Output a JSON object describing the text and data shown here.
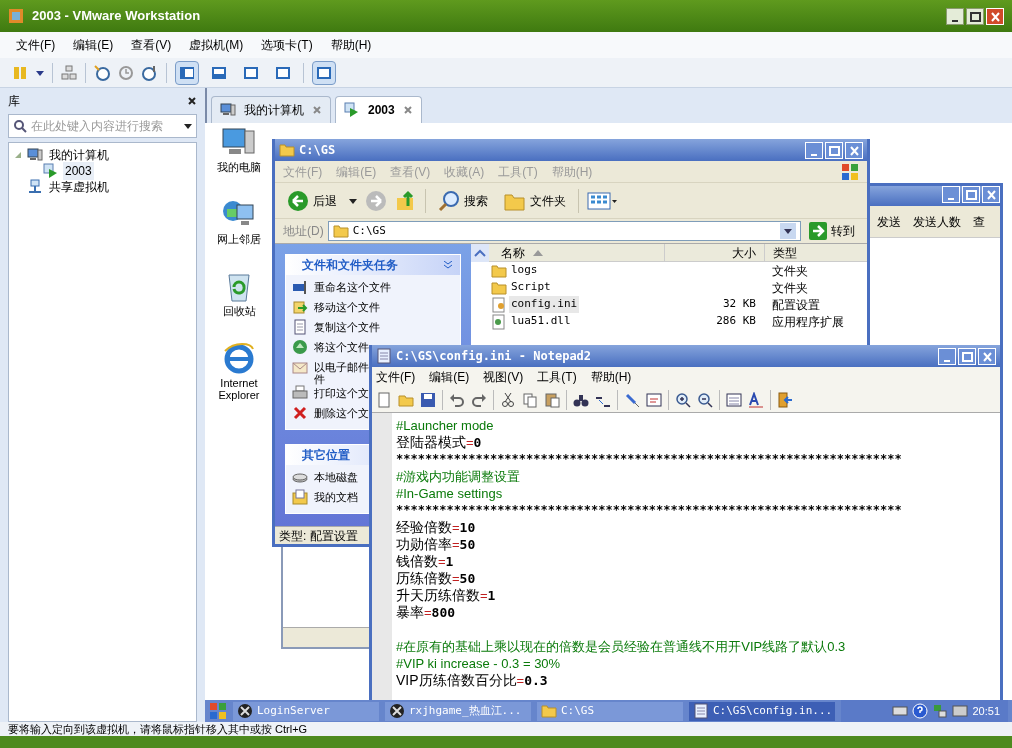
{
  "window": {
    "title": "2003 - VMware Workstation"
  },
  "menu": [
    "文件(F)",
    "编辑(E)",
    "查看(V)",
    "虚拟机(M)",
    "选项卡(T)",
    "帮助(H)"
  ],
  "view_buttons": [
    {
      "selected": true
    },
    {
      "selected": false
    },
    {
      "selected": false
    },
    {
      "selected": false
    },
    {
      "selected": true
    }
  ],
  "library": {
    "title": "库",
    "search": {
      "placeholder": "在此处键入内容进行搜索"
    },
    "tree": [
      {
        "label": "我的计算机",
        "kind": "computer",
        "expanded": true,
        "selected": false,
        "children": [
          {
            "label": "2003",
            "kind": "vm",
            "selected": true
          }
        ]
      },
      {
        "label": "共享虚拟机",
        "kind": "shared",
        "selected": false
      }
    ]
  },
  "tabs": [
    {
      "label": "我的计算机",
      "kind": "computer",
      "selected": false
    },
    {
      "label": "2003",
      "kind": "vm",
      "selected": true
    }
  ],
  "desktop_icons": [
    {
      "label": "我的电脑",
      "kind": "computer"
    },
    {
      "label": "网上邻居",
      "kind": "network"
    },
    {
      "label": "回收站",
      "kind": "recycle"
    },
    {
      "label": "Internet Explorer",
      "kind": "browser"
    }
  ],
  "background_window": {
    "toolbar": [
      "发送",
      "发送人数",
      "查"
    ]
  },
  "explorer": {
    "title": "C:\\GS",
    "menu": [
      "文件(F)",
      "编辑(E)",
      "查看(V)",
      "收藏(A)",
      "工具(T)",
      "帮助(H)"
    ],
    "back": "后退",
    "search": "搜索",
    "folders": "文件夹",
    "address_label": "地址(D)",
    "address": "C:\\GS",
    "go": "转到",
    "panels": [
      {
        "title": "文件和文件夹任务",
        "items": [
          {
            "label": "重命名这个文件",
            "kind": "rename",
            "wrapped": false
          },
          {
            "label": "移动这个文件",
            "kind": "move",
            "wrapped": false
          },
          {
            "label": "复制这个文件",
            "kind": "copy",
            "wrapped": false
          },
          {
            "label": "将这个文件",
            "kind": "web",
            "wrapped": false
          },
          {
            "label": "以电子邮件件",
            "kind": "mail",
            "wrapped": true
          },
          {
            "label": "打印这个文",
            "kind": "print",
            "wrapped": false
          },
          {
            "label": "删除这个文",
            "kind": "delete",
            "wrapped": false
          }
        ]
      },
      {
        "title": "其它位置",
        "items": [
          {
            "label": "本地磁盘",
            "kind": "disk",
            "wrapped": false
          },
          {
            "label": "我的文档",
            "kind": "documents",
            "wrapped": false
          }
        ]
      }
    ],
    "columns": [
      "名称",
      "大小",
      "类型"
    ],
    "rows": [
      {
        "name": "logs",
        "type": "文件夹",
        "kind": "folder",
        "selected": false
      },
      {
        "name": "Script",
        "type": "文件夹",
        "kind": "folder",
        "selected": false
      },
      {
        "name": "config.ini",
        "size": "32 KB",
        "type": "配置设置",
        "kind": "ini",
        "selected": true
      },
      {
        "name": "lua51.dll",
        "size": "286 KB",
        "type": "应用程序扩展",
        "kind": "dll",
        "selected": false
      }
    ],
    "status": "类型: 配置设置"
  },
  "notepad": {
    "title": "C:\\GS\\config.ini - Notepad2",
    "menu": [
      "文件(F)",
      "编辑(E)",
      "视图(V)",
      "工具(T)",
      "帮助(H)"
    ],
    "lines": [
      {
        "kind": "comment",
        "text": "#Launcher mode"
      },
      {
        "kind": "setting",
        "key": "登陆器模式",
        "operator": "=",
        "value": "0"
      },
      {
        "kind": "separator",
        "text": "**********************************************************************"
      },
      {
        "kind": "comment",
        "text": "#游戏内功能调整设置"
      },
      {
        "kind": "comment",
        "text": "#In-Game settings"
      },
      {
        "kind": "separator",
        "text": "**********************************************************************"
      },
      {
        "kind": "setting",
        "key": "经验倍数",
        "operator": "=",
        "value": "10"
      },
      {
        "kind": "setting",
        "key": "功勋倍率",
        "operator": "=",
        "value": "50"
      },
      {
        "kind": "setting",
        "key": "钱倍数",
        "operator": "=",
        "value": "1"
      },
      {
        "kind": "setting",
        "key": "历练倍数",
        "operator": "=",
        "value": "50"
      },
      {
        "kind": "setting",
        "key": "升天历练倍数",
        "operator": "=",
        "value": "1"
      },
      {
        "kind": "setting",
        "key": "暴率",
        "operator": "=",
        "value": "800"
      },
      {
        "kind": "blank"
      },
      {
        "kind": "comment",
        "text": "#在原有的基础上乘以现在的倍数是会员经验在普通线不用开VIP线路了默认0.3"
      },
      {
        "kind": "comment",
        "text": "#VIP ki increase - 0.3 = 30%"
      },
      {
        "kind": "setting",
        "key": "VIP历练倍数百分比",
        "operator": "=",
        "value": "0.3"
      }
    ]
  },
  "guest_taskbar": {
    "items": [
      {
        "label": "LoginServer",
        "kind": "app",
        "selected": false
      },
      {
        "label": "rxjhgame_热血江...",
        "kind": "app",
        "selected": false
      },
      {
        "label": "C:\\GS",
        "kind": "folder",
        "selected": false
      },
      {
        "label": "C:\\GS\\config.in...",
        "kind": "notepad",
        "selected": true
      }
    ],
    "clock": "20:51"
  },
  "status_bar": "要将输入定向到该虚拟机，请将鼠标指针移入其中或按 Ctrl+G"
}
